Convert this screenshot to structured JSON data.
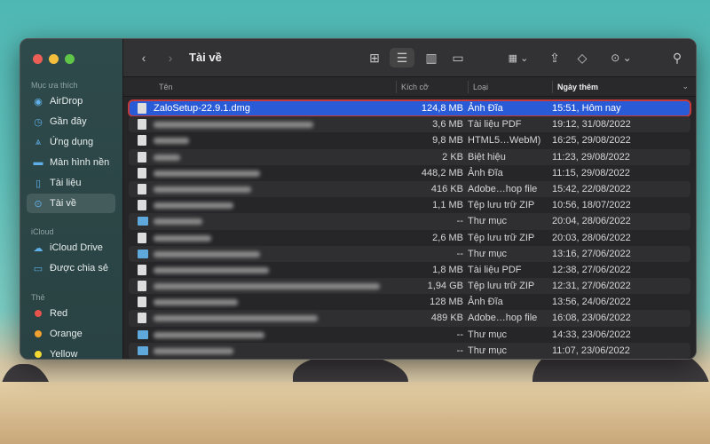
{
  "window": {
    "title": "Tài về",
    "back_icon": "chevron-left-icon",
    "forward_icon": "chevron-right-icon"
  },
  "sidebar": {
    "favorites_label": "Mục ưa thích",
    "favorites": [
      {
        "label": "AirDrop",
        "icon": "airdrop-icon"
      },
      {
        "label": "Gần đây",
        "icon": "clock-icon"
      },
      {
        "label": "Ứng dụng",
        "icon": "apps-icon"
      },
      {
        "label": "Màn hình nền",
        "icon": "desktop-icon"
      },
      {
        "label": "Tài liệu",
        "icon": "document-icon"
      },
      {
        "label": "Tài về",
        "icon": "download-icon",
        "active": true
      }
    ],
    "icloud_label": "iCloud",
    "icloud": [
      {
        "label": "iCloud Drive",
        "icon": "cloud-icon"
      },
      {
        "label": "Được chia sẻ",
        "icon": "shared-folder-icon"
      }
    ],
    "tags_label": "Thẻ",
    "tags": [
      {
        "label": "Red",
        "color": "#e5534b"
      },
      {
        "label": "Orange",
        "color": "#f0a030"
      },
      {
        "label": "Yellow",
        "color": "#f2d833"
      }
    ]
  },
  "toolbar": {
    "icons": [
      "icon-view",
      "list-view",
      "column-view",
      "gallery-view",
      "group-by",
      "share",
      "tag",
      "more-actions",
      "search"
    ],
    "active_view": "list-view"
  },
  "columns": {
    "name": "Tên",
    "size": "Kích cỡ",
    "kind": "Loại",
    "date": "Ngày thêm",
    "sort": "Ngày thêm"
  },
  "files": [
    {
      "name": "ZaloSetup-22.9.1.dmg",
      "size": "124,8 MB",
      "kind": "Ảnh Đĩa",
      "date": "15:51, Hôm nay",
      "selected": true,
      "type": "file"
    },
    {
      "size": "3,6 MB",
      "kind": "Tài liệu PDF",
      "date": "19:12, 31/08/2022",
      "type": "file"
    },
    {
      "size": "9,8 MB",
      "kind": "HTML5…WebM)",
      "date": "16:25, 29/08/2022",
      "type": "file"
    },
    {
      "size": "2 KB",
      "kind": "Biệt hiệu",
      "date": "11:23, 29/08/2022",
      "type": "file"
    },
    {
      "size": "448,2 MB",
      "kind": "Ảnh Đĩa",
      "date": "11:15, 29/08/2022",
      "type": "file"
    },
    {
      "size": "416 KB",
      "kind": "Adobe…hop file",
      "date": "15:42, 22/08/2022",
      "type": "file"
    },
    {
      "size": "1,1 MB",
      "kind": "Tệp lưu trữ ZIP",
      "date": "10:56, 18/07/2022",
      "type": "file"
    },
    {
      "size": "--",
      "kind": "Thư mục",
      "date": "20:04, 28/06/2022",
      "type": "folder"
    },
    {
      "size": "2,6 MB",
      "kind": "Tệp lưu trữ ZIP",
      "date": "20:03, 28/06/2022",
      "type": "file"
    },
    {
      "size": "--",
      "kind": "Thư mục",
      "date": "13:16, 27/06/2022",
      "type": "folder"
    },
    {
      "size": "1,8 MB",
      "kind": "Tài liệu PDF",
      "date": "12:38, 27/06/2022",
      "type": "file"
    },
    {
      "size": "1,94 GB",
      "kind": "Tệp lưu trữ ZIP",
      "date": "12:31, 27/06/2022",
      "type": "file"
    },
    {
      "size": "128 MB",
      "kind": "Ảnh Đĩa",
      "date": "13:56, 24/06/2022",
      "type": "file"
    },
    {
      "size": "489 KB",
      "kind": "Adobe…hop file",
      "date": "16:08, 23/06/2022",
      "type": "file"
    },
    {
      "size": "--",
      "kind": "Thư mục",
      "date": "14:33, 23/06/2022",
      "type": "folder"
    },
    {
      "size": "--",
      "kind": "Thư mục",
      "date": "11:07, 23/06/2022",
      "type": "folder"
    }
  ]
}
